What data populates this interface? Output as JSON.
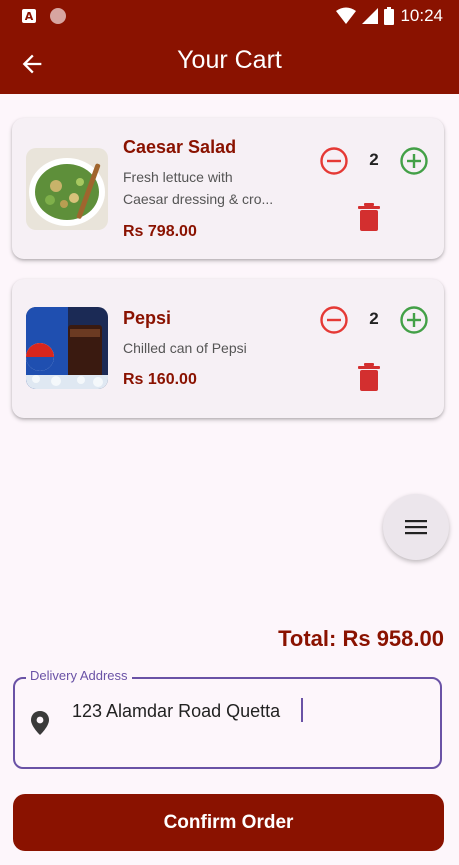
{
  "status_bar": {
    "time": "10:24",
    "left_icon_letter": "A"
  },
  "app_bar": {
    "title": "Your Cart",
    "back_icon": "arrow-left-icon"
  },
  "cart": {
    "items": [
      {
        "name": "Caesar Salad",
        "desc_line1": "Fresh lettuce with",
        "desc_line2": "Caesar dressing & cro...",
        "price": "Rs 798.00",
        "quantity": "2",
        "image": "caesar-salad-image"
      },
      {
        "name": "Pepsi",
        "desc_line1": "Chilled can of Pepsi",
        "price": "Rs 160.00",
        "quantity": "2",
        "image": "pepsi-image"
      }
    ]
  },
  "fab": {
    "icon": "menu-icon"
  },
  "total": {
    "text": "Total: Rs 958.00"
  },
  "address": {
    "label": "Delivery Address",
    "value": "123 Alamdar Road Quetta",
    "icon": "location-pin-icon"
  },
  "confirm": {
    "label": "Confirm Order"
  },
  "colors": {
    "primary": "#8a1200",
    "minus": "#e53935",
    "plus": "#43a047",
    "trash": "#d32f2f",
    "focus": "#6a52a6"
  }
}
